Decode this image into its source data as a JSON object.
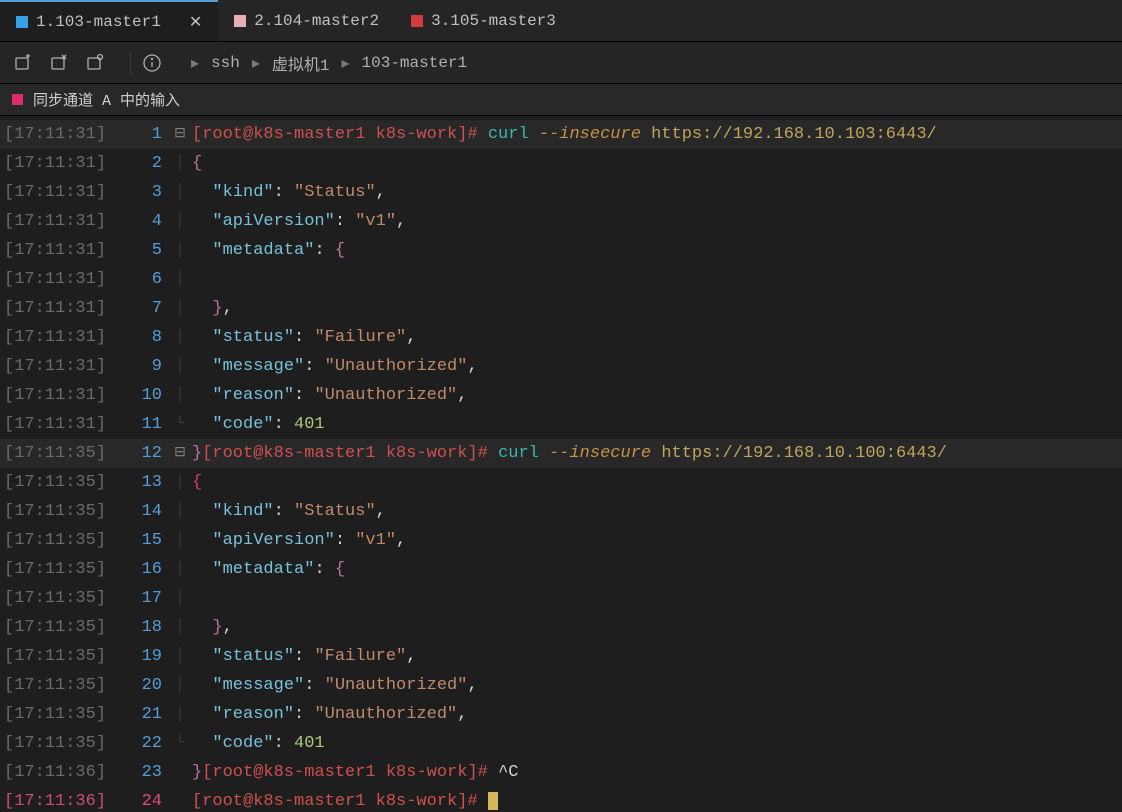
{
  "tabs": [
    {
      "label": "1.103-master1",
      "color": "sq-blue",
      "active": true,
      "closable": true
    },
    {
      "label": "2.104-master2",
      "color": "sq-pink",
      "active": false,
      "closable": false
    },
    {
      "label": "3.105-master3",
      "color": "sq-red",
      "active": false,
      "closable": false
    }
  ],
  "breadcrumb": {
    "a": "ssh",
    "b": "虚拟机1",
    "c": "103-master1"
  },
  "sync_label": "同步通道  A  中的输入",
  "prompt_text": "[root@k8s-master1 k8s-work]#",
  "cmd": "curl",
  "opt": "--insecure",
  "url1": "https://192.168.10.103:6443/",
  "url2": "https://192.168.10.100:6443/",
  "interrupt": "^C",
  "json_pairs": {
    "kind": "\"kind\"",
    "kind_v": "\"Status\"",
    "api": "\"apiVersion\"",
    "api_v": "\"v1\"",
    "meta": "\"metadata\"",
    "status": "\"status\"",
    "status_v": "\"Failure\"",
    "msg": "\"message\"",
    "msg_v": "\"Unauthorized\"",
    "reason": "\"reason\"",
    "reason_v": "\"Unauthorized\"",
    "code": "\"code\"",
    "code_v": "401"
  },
  "lines": [
    {
      "ts": "[17:11:31]",
      "ln": "1",
      "fold": "⊟"
    },
    {
      "ts": "[17:11:31]",
      "ln": "2"
    },
    {
      "ts": "[17:11:31]",
      "ln": "3"
    },
    {
      "ts": "[17:11:31]",
      "ln": "4"
    },
    {
      "ts": "[17:11:31]",
      "ln": "5"
    },
    {
      "ts": "[17:11:31]",
      "ln": "6"
    },
    {
      "ts": "[17:11:31]",
      "ln": "7"
    },
    {
      "ts": "[17:11:31]",
      "ln": "8"
    },
    {
      "ts": "[17:11:31]",
      "ln": "9"
    },
    {
      "ts": "[17:11:31]",
      "ln": "10"
    },
    {
      "ts": "[17:11:31]",
      "ln": "11"
    },
    {
      "ts": "[17:11:35]",
      "ln": "12",
      "fold": "⊟"
    },
    {
      "ts": "[17:11:35]",
      "ln": "13"
    },
    {
      "ts": "[17:11:35]",
      "ln": "14"
    },
    {
      "ts": "[17:11:35]",
      "ln": "15"
    },
    {
      "ts": "[17:11:35]",
      "ln": "16"
    },
    {
      "ts": "[17:11:35]",
      "ln": "17"
    },
    {
      "ts": "[17:11:35]",
      "ln": "18"
    },
    {
      "ts": "[17:11:35]",
      "ln": "19"
    },
    {
      "ts": "[17:11:35]",
      "ln": "20"
    },
    {
      "ts": "[17:11:35]",
      "ln": "21"
    },
    {
      "ts": "[17:11:35]",
      "ln": "22"
    },
    {
      "ts": "[17:11:36]",
      "ln": "23"
    },
    {
      "ts": "[17:11:36]",
      "ln": "24",
      "hot": true
    }
  ]
}
